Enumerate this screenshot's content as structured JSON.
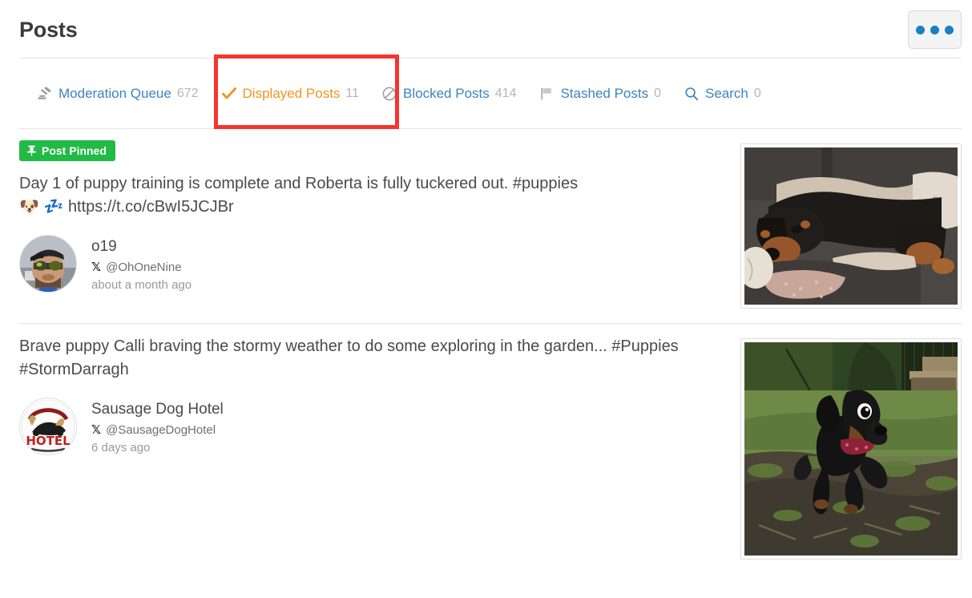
{
  "header": {
    "title": "Posts",
    "menu_button_label": "•••",
    "menu_dot_color": "#1b7fc4"
  },
  "tabs": [
    {
      "label": "Moderation Queue",
      "count": "672",
      "icon": "gavel-icon",
      "active": false
    },
    {
      "label": "Displayed Posts",
      "count": "11",
      "icon": "check-icon",
      "active": true
    },
    {
      "label": "Blocked Posts",
      "count": "414",
      "icon": "block-icon",
      "active": false
    },
    {
      "label": "Stashed Posts",
      "count": "0",
      "icon": "flag-icon",
      "active": false
    },
    {
      "label": "Search",
      "count": "0",
      "icon": "search-icon",
      "active": false
    }
  ],
  "annotation": {
    "target": "Displayed Posts",
    "color": "#f5352e"
  },
  "colors": {
    "tab_link": "#3b83c0",
    "tab_active": "#f2941f",
    "tab_count": "#b5b5b5",
    "badge_green": "#21ba45",
    "annotation_red": "#f5352e"
  },
  "posts": [
    {
      "pinned": true,
      "pinned_label": "Post Pinned",
      "pin_icon": "pin-icon",
      "text": "Day 1 of puppy training is complete and Roberta is fully tuckered out. #puppies",
      "emoji": "🐶 💤",
      "link": "https://t.co/cBwI5JCJBr",
      "author_name": "o19",
      "author_handle": "@OhOneNine",
      "platform_icon": "x-icon",
      "timestamp": "about a month ago",
      "avatar_name": "avatar-o19",
      "thumbnail_name": "post-image-sleeping-rottweiler-puppy"
    },
    {
      "pinned": false,
      "pinned_label": "",
      "pin_icon": "",
      "text": "Brave puppy Calli braving the stormy weather to do some exploring in the garden... #Puppies #StormDarragh",
      "emoji": "",
      "link": "",
      "author_name": "Sausage Dog Hotel",
      "author_handle": "@SausageDogHotel",
      "platform_icon": "x-icon",
      "timestamp": "6 days ago",
      "avatar_name": "avatar-sausage-dog-hotel",
      "thumbnail_name": "post-image-running-dachshund-puppy"
    }
  ]
}
